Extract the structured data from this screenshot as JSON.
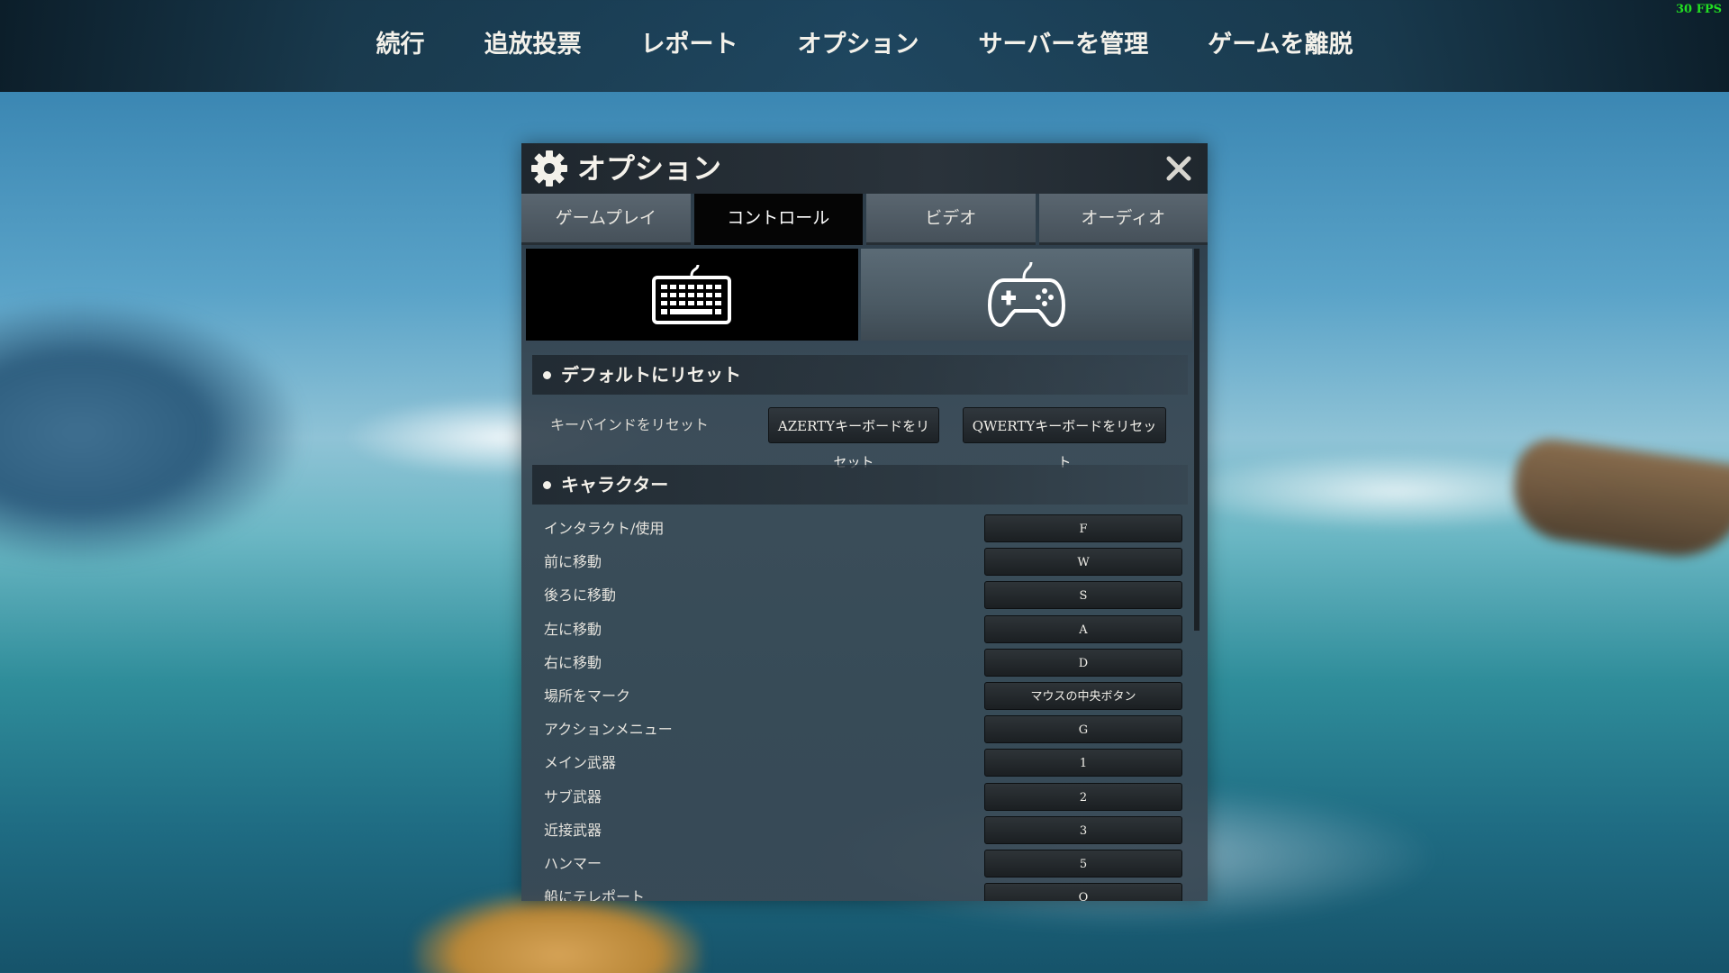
{
  "fps": "30 FPS",
  "topnav": {
    "items": [
      "続行",
      "追放投票",
      "レポート",
      "オプション",
      "サーバーを管理",
      "ゲームを離脱"
    ]
  },
  "dialog": {
    "title": "オプション",
    "icons": {
      "header": "gear-icon",
      "close": "close-icon",
      "keyboard": "keyboard-icon",
      "gamepad": "gamepad-icon"
    },
    "tabs": [
      {
        "label": "ゲームプレイ",
        "active": false
      },
      {
        "label": "コントロール",
        "active": true
      },
      {
        "label": "ビデオ",
        "active": false
      },
      {
        "label": "オーディオ",
        "active": false
      }
    ],
    "reset_section": {
      "title": "デフォルトにリセット",
      "label": "キーバインドをリセット",
      "azerty_button": "AZERTYキーボードをリセット",
      "qwerty_button": "QWERTYキーボードをリセット"
    },
    "character_section": {
      "title": "キャラクター",
      "bindings": [
        {
          "action": "インタラクト/使用",
          "key": "F"
        },
        {
          "action": "前に移動",
          "key": "W"
        },
        {
          "action": "後ろに移動",
          "key": "S"
        },
        {
          "action": "左に移動",
          "key": "A"
        },
        {
          "action": "右に移動",
          "key": "D"
        },
        {
          "action": "場所をマーク",
          "key": "マウスの中央ボタン"
        },
        {
          "action": "アクションメニュー",
          "key": "G"
        },
        {
          "action": "メイン武器",
          "key": "1"
        },
        {
          "action": "サブ武器",
          "key": "2"
        },
        {
          "action": "近接武器",
          "key": "3"
        },
        {
          "action": "ハンマー",
          "key": "5"
        },
        {
          "action": "船にテレポート",
          "key": "Q"
        }
      ]
    }
  },
  "colors": {
    "fps": "#22e022",
    "active_tab": "#050505"
  }
}
